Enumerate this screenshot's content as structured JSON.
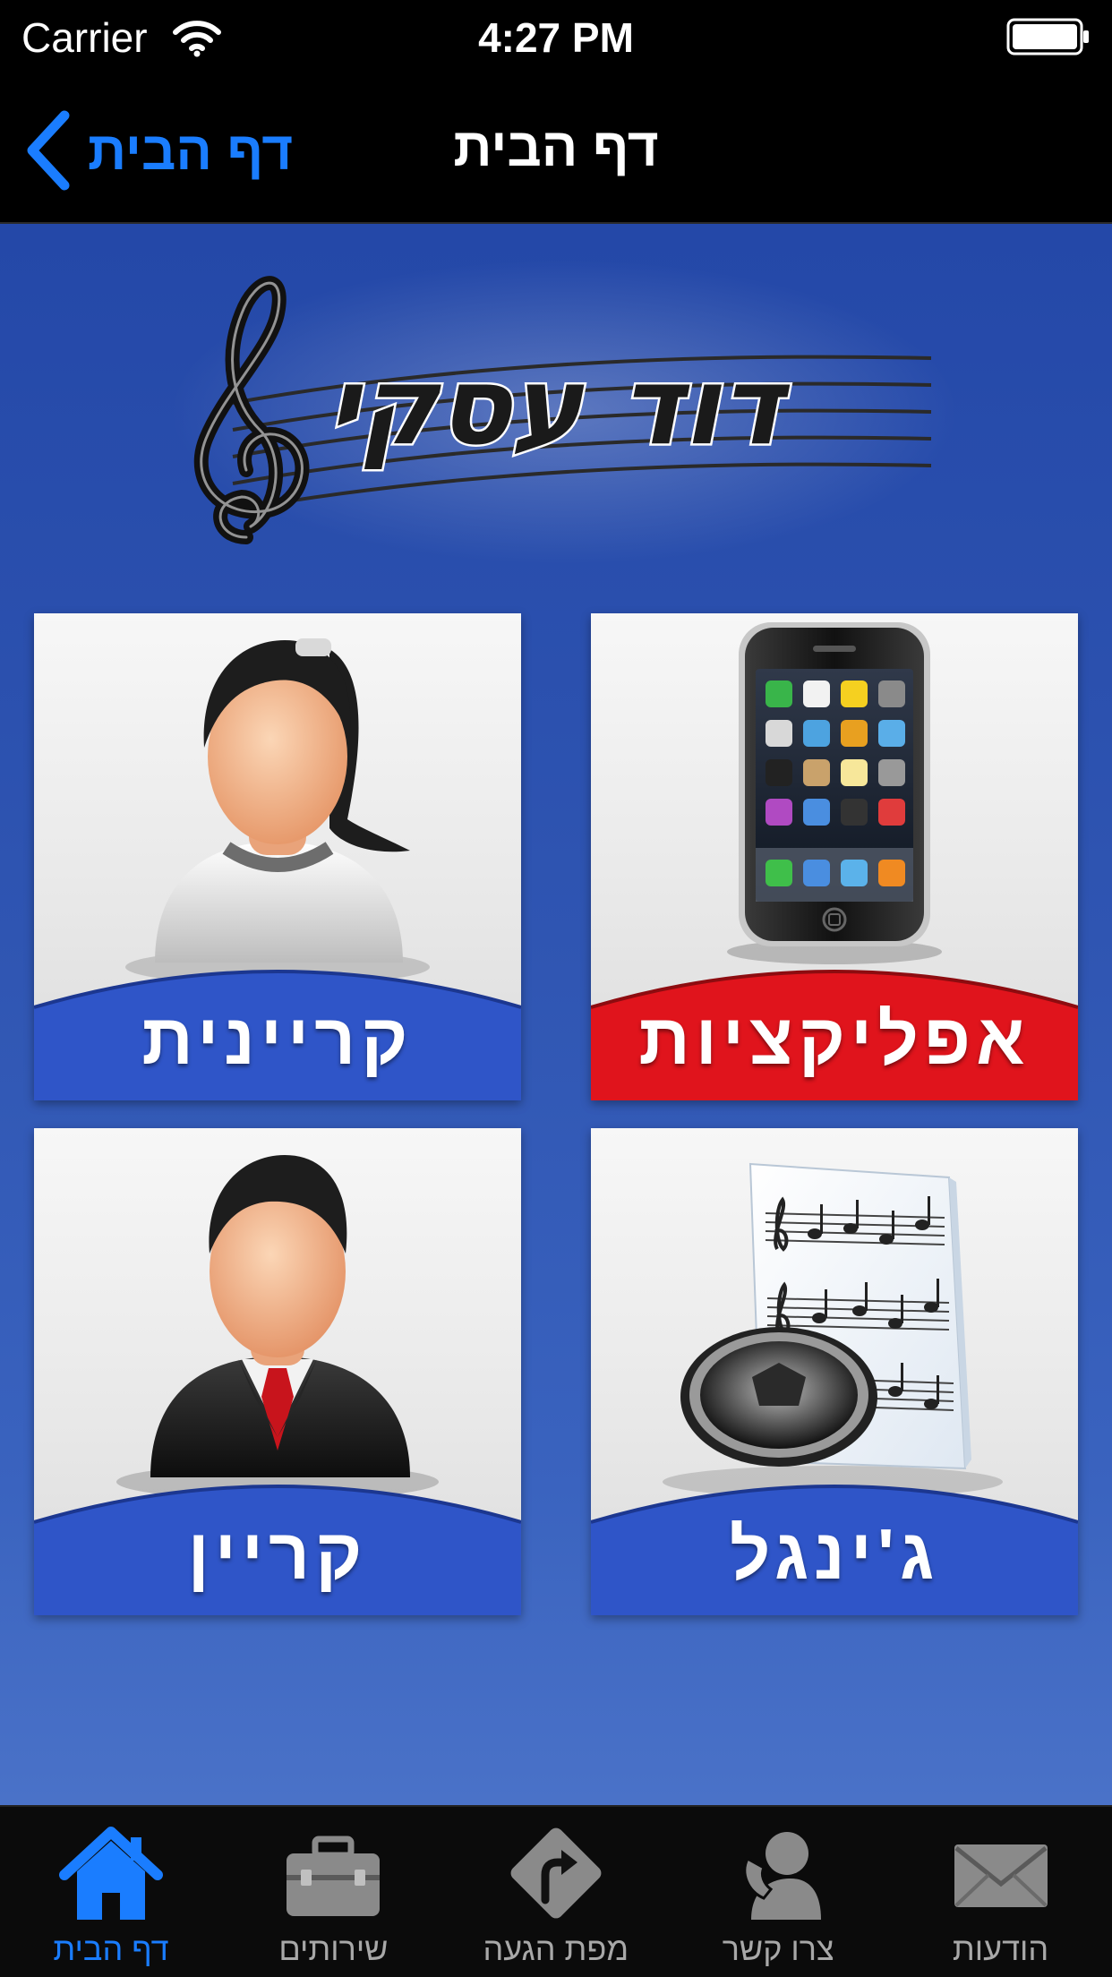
{
  "status_bar": {
    "carrier": "Carrier",
    "time": "4:27 PM"
  },
  "nav": {
    "back_label": "דף הבית",
    "title": "דף הבית",
    "back_color": "#1a7dff"
  },
  "logo": {
    "text": "דוד עסקי"
  },
  "tiles": [
    {
      "label": "קריינית",
      "band_color": "#2f55c8",
      "icon": "woman-avatar-icon"
    },
    {
      "label": "אפליקציות",
      "band_color": "#e0141c",
      "icon": "smartphone-icon"
    },
    {
      "label": "קריין",
      "band_color": "#2f55c8",
      "icon": "man-avatar-icon"
    },
    {
      "label": "ג'ינגל",
      "band_color": "#2f55c8",
      "icon": "sheet-music-speaker-icon"
    }
  ],
  "tab_bar": {
    "active_color": "#1a7dff",
    "inactive_color": "#a8a8a8",
    "tabs": [
      {
        "label": "דף הבית",
        "icon": "home-icon",
        "active": true
      },
      {
        "label": "שירותים",
        "icon": "briefcase-icon",
        "active": false
      },
      {
        "label": "מפת הגעה",
        "icon": "directions-sign-icon",
        "active": false
      },
      {
        "label": "צרו קשר",
        "icon": "contact-person-icon",
        "active": false
      },
      {
        "label": "הודעות",
        "icon": "envelope-icon",
        "active": false
      }
    ]
  }
}
